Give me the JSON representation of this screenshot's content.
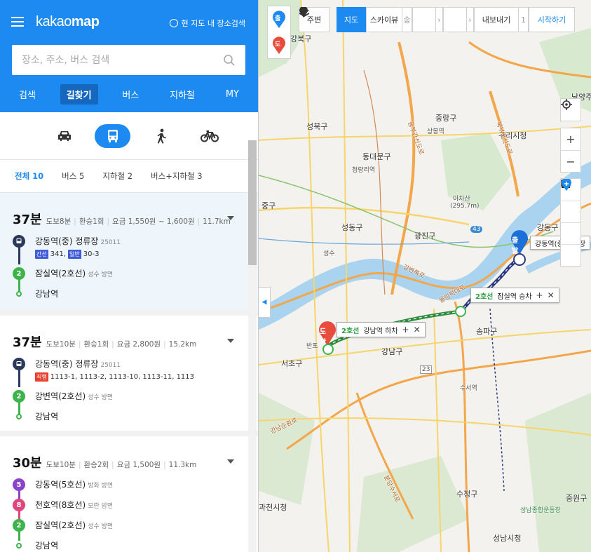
{
  "header": {
    "menu_icon": "hamburger-icon",
    "logo_light": "kakao",
    "logo_bold": "map",
    "map_search_label": "현 지도 내 장소검색",
    "search_placeholder": "장소, 주소, 버스 검색",
    "tabs": [
      "검색",
      "길찾기",
      "버스",
      "지하철",
      "MY"
    ],
    "active_tab": "길찾기"
  },
  "modes": {
    "items": [
      "car-icon",
      "bus-icon",
      "walk-icon",
      "bicycle-icon"
    ],
    "active": "bus-icon"
  },
  "filters": [
    "전체 10",
    "버스 5",
    "지하철 2",
    "버스+지하철 3"
  ],
  "results": [
    {
      "duration": "37분",
      "walk": "도보8분",
      "transfer": "환승1회",
      "fare": "요금 1,550원 ~ 1,600원",
      "distance": "11.7km",
      "steps": [
        {
          "type": "bus",
          "name": "강동역(중) 정류장",
          "sub": "25011",
          "buses": [
            {
              "tag": "간선",
              "tag_color": "#3d5bd9",
              "nums": "341,"
            },
            {
              "tag": "일반",
              "tag_color": "#3d5bd9",
              "nums": "30-3"
            }
          ]
        },
        {
          "type": "line",
          "num": "2",
          "color": "#3db44a",
          "name": "잠실역(2호선)",
          "sub": "성수 방면"
        },
        {
          "type": "end",
          "name": "강남역"
        }
      ]
    },
    {
      "duration": "37분",
      "walk": "도보10분",
      "transfer": "환승1회",
      "fare": "요금 2,800원",
      "distance": "15.2km",
      "steps": [
        {
          "type": "bus",
          "name": "강동역(중) 정류장",
          "sub": "25011",
          "buses": [
            {
              "tag": "직행",
              "tag_color": "#e8402f",
              "nums": "1113-1, 1113-2, 1113-10, 1113-11, 1113"
            }
          ]
        },
        {
          "type": "line",
          "num": "2",
          "color": "#3db44a",
          "name": "강변역(2호선)",
          "sub": "성수 방면"
        },
        {
          "type": "end",
          "name": "강남역"
        }
      ]
    },
    {
      "duration": "30분",
      "walk": "도보10분",
      "transfer": "환승2회",
      "fare": "요금 1,500원",
      "distance": "11.3km",
      "steps": [
        {
          "type": "line",
          "num": "5",
          "color": "#8b44c9",
          "name": "강동역(5호선)",
          "sub": "방화 방면"
        },
        {
          "type": "line",
          "num": "8",
          "color": "#e0457b",
          "name": "천호역(8호선)",
          "sub": "모란 방면"
        },
        {
          "type": "line",
          "num": "2",
          "color": "#3db44a",
          "name": "잠실역(2호선)",
          "sub": "성수 방면"
        },
        {
          "type": "end",
          "name": "강남역"
        }
      ]
    }
  ],
  "map": {
    "toolbar": {
      "start_marker": "출",
      "end_marker": "도",
      "nearby": "주변",
      "map": "지도",
      "skyview": "스카이뷰",
      "skyview_extra": "송",
      "export": "내보내기",
      "export_extra": "1",
      "start_button": "시작하기"
    },
    "labels": {
      "gangbuk": "강북구",
      "seongbuk": "성북구",
      "dongdaemun": "동대문구",
      "jungnang": "중랑구",
      "sangbong": "상봉역",
      "cheongnyangni": "청량리역",
      "guri": "구리시청",
      "seongdong": "성동구",
      "gwangjin": "광진구",
      "achasan": "아차산",
      "achasan_h": "(295.7m)",
      "gangdong": "강동구",
      "junggu": "중구",
      "seocho": "서초구",
      "gangnam": "강남구",
      "songpa": "송파구",
      "gwacheon": "과천시청",
      "sujeong": "수정구",
      "jungwon": "중원구",
      "seongnam": "성남시청",
      "seongnam_stadium": "성남종합운동장",
      "namyang": "남양주",
      "suseo": "수서역",
      "banpo": "반포",
      "suseong": "성수",
      "sangbong_line": "상봉역",
      "route43": "43",
      "route23": "23",
      "route3": "3",
      "route47": "47",
      "dongbu": "동부간선도로",
      "bukbu": "북부간선도로",
      "olympic": "올림픽대로",
      "gangbyeon": "강변북로",
      "gangnamsunhwan": "강남순환로",
      "bundang": "분당수서로"
    },
    "pins": {
      "start_label": "출발",
      "start_stop": "강동역(중)정류장",
      "end_label": "도착",
      "transfer_line": "2호선",
      "transfer_text": "잠실역 승차",
      "arrive_line": "2호선",
      "arrive_text": "강남역 하차"
    }
  },
  "colors": {
    "brand": "#1c8af0",
    "line2": "#3db44a",
    "bus_route": "#2b3a80",
    "river": "#a9d3ee"
  }
}
